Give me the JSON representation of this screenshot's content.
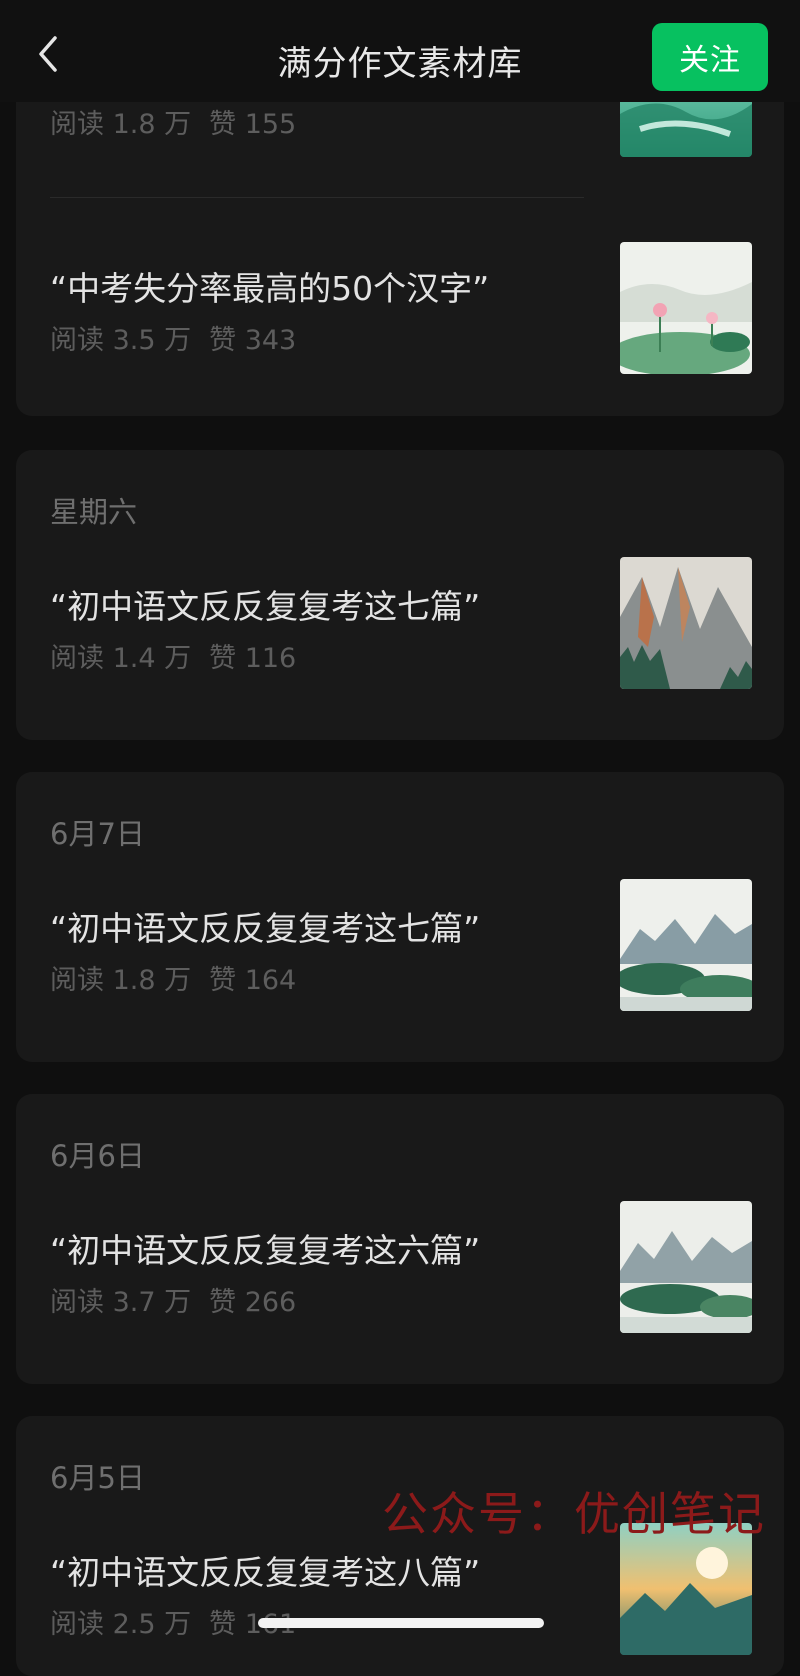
{
  "header": {
    "title": "满分作文素材库",
    "follow_label": "关注",
    "back_icon": "chevron-left-icon"
  },
  "cards": [
    {
      "date": "",
      "articles": [
        {
          "title": "",
          "reads": "阅读 1.8 万",
          "likes": "赞 155",
          "thumb": "green-landscape-thumbnail"
        },
        {
          "title": "“中考失分率最高的50个汉字”",
          "reads": "阅读 3.5 万",
          "likes": "赞 343",
          "thumb": "lotus-painting-thumbnail"
        }
      ]
    },
    {
      "date": "星期六",
      "articles": [
        {
          "title": "“初中语文反反复复考这七篇”",
          "reads": "阅读 1.4 万",
          "likes": "赞 116",
          "thumb": "mountain-painting-thumbnail"
        }
      ]
    },
    {
      "date": "6月7日",
      "articles": [
        {
          "title": "“初中语文反反复复考这七篇”",
          "reads": "阅读 1.8 万",
          "likes": "赞 164",
          "thumb": "misty-mountains-thumbnail"
        }
      ]
    },
    {
      "date": "6月6日",
      "articles": [
        {
          "title": "“初中语文反反复复考这六篇”",
          "reads": "阅读 3.7 万",
          "likes": "赞 266",
          "thumb": "misty-mountains-thumbnail"
        }
      ]
    },
    {
      "date": "6月5日",
      "articles": [
        {
          "title": "“初中语文反反复复考这八篇”",
          "reads": "阅读 2.5 万",
          "likes": "赞 161",
          "thumb": "sunset-landscape-thumbnail"
        }
      ]
    }
  ],
  "watermark": "公众号：优创笔记",
  "colors": {
    "accent": "#07c160",
    "background": "#0f0f0f",
    "card": "#191919",
    "watermark": "#8c1a1a"
  }
}
